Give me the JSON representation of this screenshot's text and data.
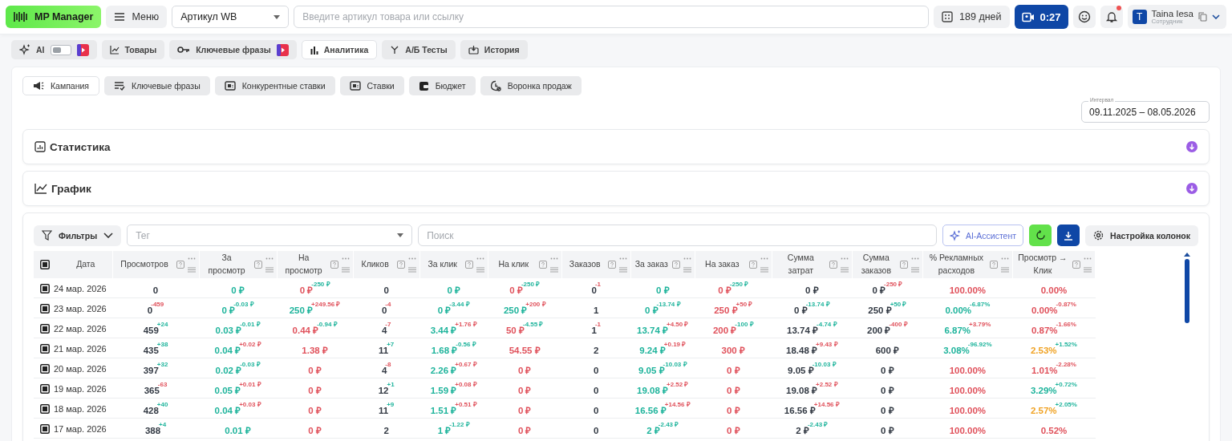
{
  "top_bar": {
    "logo": "MP Manager",
    "menu": "Меню",
    "article_select": "Артикул WB",
    "search": {
      "placeholder": "Введите артикул товара или ссылку"
    },
    "days": "189 дней",
    "timer": "0:27",
    "notifications_unread": true,
    "user": {
      "avatar": "T",
      "name": "Taina Iesa",
      "role": "Сотрудник"
    }
  },
  "nav_tabs": [
    {
      "label": "AI",
      "kind": "toggle",
      "on": false,
      "badge": true,
      "selected": false
    },
    {
      "label": "Товары",
      "kind": "tab",
      "badge": false,
      "selected": false
    },
    {
      "label": "Ключевые фразы",
      "kind": "tab",
      "badge": true,
      "selected": false
    },
    {
      "label": "Аналитика",
      "kind": "tab",
      "badge": false,
      "selected": true
    },
    {
      "label": "А/Б Тесты",
      "kind": "tab",
      "badge": false,
      "selected": false
    },
    {
      "label": "История",
      "kind": "tab",
      "badge": false,
      "selected": false
    }
  ],
  "sub_tabs": [
    {
      "label": "Кампания",
      "selected": true
    },
    {
      "label": "Ключевые фразы",
      "selected": false
    },
    {
      "label": "Конкурентные ставки",
      "selected": false
    },
    {
      "label": "Ставки",
      "selected": false
    },
    {
      "label": "Бюджет",
      "selected": false
    },
    {
      "label": "Воронка продаж",
      "selected": false
    }
  ],
  "interval": {
    "label": "Интервал",
    "value": "09.11.2025 – 08.05.2026"
  },
  "sections": [
    {
      "title": "Статистика",
      "expanded": false
    },
    {
      "title": "График",
      "expanded": false
    }
  ],
  "toolbar": {
    "filters": "Фильтры",
    "tag": {
      "placeholder": "Тег"
    },
    "search": {
      "placeholder": "Поиск"
    },
    "ai_assistant": "AI-Ассистент",
    "columns_settings": "Настройка колонок"
  },
  "table": {
    "all_checked": true,
    "columns": [
      "Дата",
      "Просмотров",
      "За просмотр",
      "На просмотр",
      "Кликов",
      "За клик",
      "На клик",
      "Заказов",
      "За заказ",
      "На заказ",
      "Сумма затрат",
      "Сумма заказов",
      "% Рекламных расходов",
      "Просмотр → Клик"
    ],
    "rows": [
      {
        "checked": true,
        "cells": [
          {
            "value": "24 мар. 2026"
          },
          {
            "value": "0",
            "color": "#333a44"
          },
          {
            "value": "0 ₽",
            "color": "#1fb49c"
          },
          {
            "value": "0 ₽",
            "color": "#e0525c",
            "delta": "-250 ₽",
            "delta_improved": true
          },
          {
            "value": "0",
            "color": "#333a44"
          },
          {
            "value": "0 ₽",
            "color": "#1fb49c"
          },
          {
            "value": "0 ₽",
            "color": "#e0525c",
            "delta": "-250 ₽",
            "delta_improved": true
          },
          {
            "value": "0",
            "color": "#333a44",
            "delta": "-1",
            "delta_improved": false
          },
          {
            "value": "0 ₽",
            "color": "#1fb49c"
          },
          {
            "value": "0 ₽",
            "color": "#e0525c",
            "delta": "-250 ₽",
            "delta_improved": true
          },
          {
            "value": "0 ₽",
            "color": "#333a44"
          },
          {
            "value": "0 ₽",
            "color": "#333a44",
            "delta": "-250 ₽",
            "delta_improved": false
          },
          {
            "value": "100.00%",
            "color": "#e0525c"
          },
          {
            "value": "0.00%",
            "color": "#e0525c"
          }
        ]
      },
      {
        "checked": true,
        "cells": [
          {
            "value": "23 мар. 2026"
          },
          {
            "value": "0",
            "color": "#333a44",
            "delta": "-459",
            "delta_improved": false
          },
          {
            "value": "0 ₽",
            "color": "#1fb49c",
            "delta": "-0.03 ₽",
            "delta_improved": true
          },
          {
            "value": "250 ₽",
            "color": "#1fb49c",
            "delta": "+249.56 ₽",
            "delta_improved": false
          },
          {
            "value": "0",
            "color": "#333a44",
            "delta": "-4",
            "delta_improved": false
          },
          {
            "value": "0 ₽",
            "color": "#1fb49c",
            "delta": "-3.44 ₽",
            "delta_improved": true
          },
          {
            "value": "250 ₽",
            "color": "#1fb49c",
            "delta": "+200 ₽",
            "delta_improved": false
          },
          {
            "value": "1",
            "color": "#333a44"
          },
          {
            "value": "0 ₽",
            "color": "#1fb49c",
            "delta": "-13.74 ₽",
            "delta_improved": true
          },
          {
            "value": "250 ₽",
            "color": "#e0525c",
            "delta": "+50 ₽",
            "delta_improved": false
          },
          {
            "value": "0 ₽",
            "color": "#333a44",
            "delta": "-13.74 ₽",
            "delta_improved": true
          },
          {
            "value": "250 ₽",
            "color": "#333a44",
            "delta": "+50 ₽",
            "delta_improved": true
          },
          {
            "value": "0.00%",
            "color": "#1fb49c",
            "delta": "-6.87%",
            "delta_improved": true
          },
          {
            "value": "0.00%",
            "color": "#e0525c",
            "delta": "-0.87%",
            "delta_improved": false
          }
        ]
      },
      {
        "checked": true,
        "cells": [
          {
            "value": "22 мар. 2026"
          },
          {
            "value": "459",
            "color": "#333a44",
            "delta": "+24",
            "delta_improved": true
          },
          {
            "value": "0.03 ₽",
            "color": "#1fb49c",
            "delta": "-0.01 ₽",
            "delta_improved": true
          },
          {
            "value": "0.44 ₽",
            "color": "#e0525c",
            "delta": "-0.94 ₽",
            "delta_improved": true
          },
          {
            "value": "4",
            "color": "#333a44",
            "delta": "-7",
            "delta_improved": false
          },
          {
            "value": "3.44 ₽",
            "color": "#1fb49c",
            "delta": "+1.76 ₽",
            "delta_improved": false
          },
          {
            "value": "50 ₽",
            "color": "#e0525c",
            "delta": "-4.55 ₽",
            "delta_improved": true
          },
          {
            "value": "1",
            "color": "#333a44",
            "delta": "-1",
            "delta_improved": false
          },
          {
            "value": "13.74 ₽",
            "color": "#1fb49c",
            "delta": "+4.50 ₽",
            "delta_improved": false
          },
          {
            "value": "200 ₽",
            "color": "#e0525c",
            "delta": "-100 ₽",
            "delta_improved": true
          },
          {
            "value": "13.74 ₽",
            "color": "#333a44",
            "delta": "-4.74 ₽",
            "delta_improved": true
          },
          {
            "value": "200 ₽",
            "color": "#333a44",
            "delta": "-400 ₽",
            "delta_improved": false
          },
          {
            "value": "6.87%",
            "color": "#1fb49c",
            "delta": "+3.79%",
            "delta_improved": false
          },
          {
            "value": "0.87%",
            "color": "#e0525c",
            "delta": "-1.66%",
            "delta_improved": false
          }
        ]
      },
      {
        "checked": true,
        "cells": [
          {
            "value": "21 мар. 2026"
          },
          {
            "value": "435",
            "color": "#333a44",
            "delta": "+38",
            "delta_improved": true
          },
          {
            "value": "0.04 ₽",
            "color": "#1fb49c",
            "delta": "+0.02 ₽",
            "delta_improved": false
          },
          {
            "value": "1.38 ₽",
            "color": "#e0525c"
          },
          {
            "value": "11",
            "color": "#333a44",
            "delta": "+7",
            "delta_improved": true
          },
          {
            "value": "1.68 ₽",
            "color": "#1fb49c",
            "delta": "-0.56 ₽",
            "delta_improved": true
          },
          {
            "value": "54.55 ₽",
            "color": "#e0525c"
          },
          {
            "value": "2",
            "color": "#333a44"
          },
          {
            "value": "9.24 ₽",
            "color": "#1fb49c",
            "delta": "+0.19 ₽",
            "delta_improved": false
          },
          {
            "value": "300 ₽",
            "color": "#e0525c"
          },
          {
            "value": "18.48 ₽",
            "color": "#333a44",
            "delta": "+9.43 ₽",
            "delta_improved": false
          },
          {
            "value": "600 ₽",
            "color": "#333a44"
          },
          {
            "value": "3.08%",
            "color": "#1fb49c",
            "delta": "-96.92%",
            "delta_improved": true
          },
          {
            "value": "2.53%",
            "color": "#f0a325",
            "delta": "+1.52%",
            "delta_improved": true
          }
        ]
      },
      {
        "checked": true,
        "cells": [
          {
            "value": "20 мар. 2026"
          },
          {
            "value": "397",
            "color": "#333a44",
            "delta": "+32",
            "delta_improved": true
          },
          {
            "value": "0.02 ₽",
            "color": "#1fb49c",
            "delta": "-0.03 ₽",
            "delta_improved": true
          },
          {
            "value": "0 ₽",
            "color": "#e0525c"
          },
          {
            "value": "4",
            "color": "#333a44",
            "delta": "-8",
            "delta_improved": false
          },
          {
            "value": "2.26 ₽",
            "color": "#1fb49c",
            "delta": "+0.67 ₽",
            "delta_improved": false
          },
          {
            "value": "0 ₽",
            "color": "#e0525c"
          },
          {
            "value": "0",
            "color": "#333a44"
          },
          {
            "value": "9.05 ₽",
            "color": "#1fb49c",
            "delta": "-10.03 ₽",
            "delta_improved": true
          },
          {
            "value": "0 ₽",
            "color": "#e0525c"
          },
          {
            "value": "9.05 ₽",
            "color": "#333a44",
            "delta": "-10.03 ₽",
            "delta_improved": true
          },
          {
            "value": "0 ₽",
            "color": "#333a44"
          },
          {
            "value": "100.00%",
            "color": "#e0525c"
          },
          {
            "value": "1.01%",
            "color": "#e0525c",
            "delta": "-2.28%",
            "delta_improved": false
          }
        ]
      },
      {
        "checked": true,
        "cells": [
          {
            "value": "19 мар. 2026"
          },
          {
            "value": "365",
            "color": "#333a44",
            "delta": "-63",
            "delta_improved": false
          },
          {
            "value": "0.05 ₽",
            "color": "#1fb49c",
            "delta": "+0.01 ₽",
            "delta_improved": false
          },
          {
            "value": "0 ₽",
            "color": "#e0525c"
          },
          {
            "value": "12",
            "color": "#333a44",
            "delta": "+1",
            "delta_improved": true
          },
          {
            "value": "1.59 ₽",
            "color": "#1fb49c",
            "delta": "+0.08 ₽",
            "delta_improved": false
          },
          {
            "value": "0 ₽",
            "color": "#e0525c"
          },
          {
            "value": "0",
            "color": "#333a44"
          },
          {
            "value": "19.08 ₽",
            "color": "#1fb49c",
            "delta": "+2.52 ₽",
            "delta_improved": false
          },
          {
            "value": "0 ₽",
            "color": "#e0525c"
          },
          {
            "value": "19.08 ₽",
            "color": "#333a44",
            "delta": "+2.52 ₽",
            "delta_improved": false
          },
          {
            "value": "0 ₽",
            "color": "#333a44"
          },
          {
            "value": "100.00%",
            "color": "#e0525c"
          },
          {
            "value": "3.29%",
            "color": "#1fb49c",
            "delta": "+0.72%",
            "delta_improved": true
          }
        ]
      },
      {
        "checked": true,
        "cells": [
          {
            "value": "18 мар. 2026"
          },
          {
            "value": "428",
            "color": "#333a44",
            "delta": "+40",
            "delta_improved": true
          },
          {
            "value": "0.04 ₽",
            "color": "#1fb49c",
            "delta": "+0.03 ₽",
            "delta_improved": false
          },
          {
            "value": "0 ₽",
            "color": "#e0525c"
          },
          {
            "value": "11",
            "color": "#333a44",
            "delta": "+9",
            "delta_improved": true
          },
          {
            "value": "1.51 ₽",
            "color": "#1fb49c",
            "delta": "+0.51 ₽",
            "delta_improved": false
          },
          {
            "value": "0 ₽",
            "color": "#e0525c"
          },
          {
            "value": "0",
            "color": "#333a44"
          },
          {
            "value": "16.56 ₽",
            "color": "#1fb49c",
            "delta": "+14.56 ₽",
            "delta_improved": false
          },
          {
            "value": "0 ₽",
            "color": "#e0525c"
          },
          {
            "value": "16.56 ₽",
            "color": "#333a44",
            "delta": "+14.56 ₽",
            "delta_improved": false
          },
          {
            "value": "0 ₽",
            "color": "#333a44"
          },
          {
            "value": "100.00%",
            "color": "#e0525c"
          },
          {
            "value": "2.57%",
            "color": "#f0a325",
            "delta": "+2.05%",
            "delta_improved": true
          }
        ]
      },
      {
        "checked": true,
        "cells": [
          {
            "value": "17 мар. 2026"
          },
          {
            "value": "388",
            "color": "#333a44",
            "delta": "+4",
            "delta_improved": true
          },
          {
            "value": "0.01 ₽",
            "color": "#1fb49c"
          },
          {
            "value": "0 ₽",
            "color": "#e0525c"
          },
          {
            "value": "2",
            "color": "#333a44"
          },
          {
            "value": "1 ₽",
            "color": "#1fb49c",
            "delta": "-1.22 ₽",
            "delta_improved": true
          },
          {
            "value": "0 ₽",
            "color": "#e0525c"
          },
          {
            "value": "0",
            "color": "#333a44"
          },
          {
            "value": "2 ₽",
            "color": "#1fb49c",
            "delta": "-2.43 ₽",
            "delta_improved": true
          },
          {
            "value": "0 ₽",
            "color": "#e0525c"
          },
          {
            "value": "2 ₽",
            "color": "#333a44",
            "delta": "-2.43 ₽",
            "delta_improved": true
          },
          {
            "value": "0 ₽",
            "color": "#333a44"
          },
          {
            "value": "100.00%",
            "color": "#e0525c"
          },
          {
            "value": "0.52%",
            "color": "#e0525c"
          }
        ]
      }
    ]
  }
}
